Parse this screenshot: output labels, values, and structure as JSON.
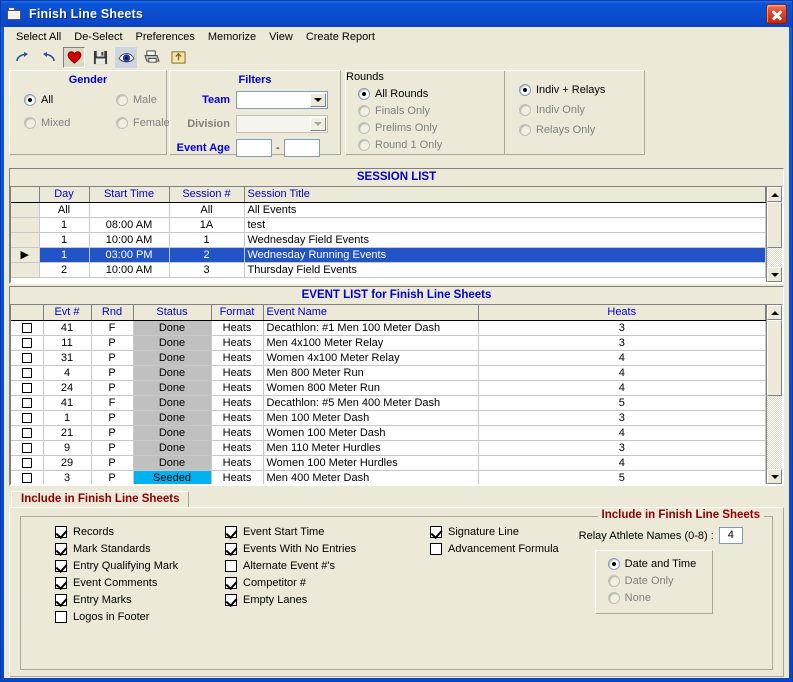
{
  "window": {
    "title": "Finish Line Sheets",
    "title_icon": "folder-icon",
    "close_icon": "close-icon"
  },
  "menubar": [
    {
      "label": "Select All"
    },
    {
      "label": "De-Select"
    },
    {
      "label": "Preferences"
    },
    {
      "label": "Memorize"
    },
    {
      "label": "View"
    },
    {
      "label": "Create Report"
    }
  ],
  "toolbar": [
    {
      "name": "redo-icon",
      "title": "Redo"
    },
    {
      "name": "undo-icon",
      "title": "Undo"
    },
    {
      "name": "heart-icon",
      "title": "Favorites"
    },
    {
      "name": "save-icon",
      "title": "Save"
    },
    {
      "name": "preview-eye-icon",
      "title": "Preview"
    },
    {
      "name": "printer-icon",
      "title": "Print"
    },
    {
      "name": "export-folder-icon",
      "title": "Export"
    }
  ],
  "gender": {
    "title": "Gender",
    "options": [
      {
        "label": "All",
        "selected": true
      },
      {
        "label": "Male",
        "selected": false
      },
      {
        "label": "Mixed",
        "selected": false
      },
      {
        "label": "Female",
        "selected": false
      }
    ]
  },
  "filters": {
    "title": "Filters",
    "team_label": "Team",
    "team_value": "",
    "division_label": "Division",
    "division_value": "",
    "division_disabled": true,
    "event_age_label": "Event Age",
    "event_age_from": "",
    "event_age_sep": "-",
    "event_age_to": ""
  },
  "rounds": {
    "title": "Rounds",
    "options": [
      {
        "label": "All Rounds",
        "selected": true
      },
      {
        "label": "Finals Only",
        "selected": false
      },
      {
        "label": "Prelims Only",
        "selected": false
      },
      {
        "label": "Round 1 Only",
        "selected": false
      }
    ]
  },
  "event_kind": {
    "options": [
      {
        "label": "Indiv + Relays",
        "selected": true
      },
      {
        "label": "Indiv Only",
        "selected": false
      },
      {
        "label": "Relays Only",
        "selected": false
      }
    ]
  },
  "session_list": {
    "caption": "SESSION LIST",
    "columns": [
      "",
      "Day",
      "Start Time",
      "Session #",
      "Session Title"
    ],
    "rows": [
      {
        "marker": "",
        "day": "All",
        "start": "",
        "session": "All",
        "title": "All Events",
        "selected": false
      },
      {
        "marker": "",
        "day": "1",
        "start": "08:00 AM",
        "session": "1A",
        "title": "test",
        "selected": false
      },
      {
        "marker": "",
        "day": "1",
        "start": "10:00 AM",
        "session": "1",
        "title": "Wednesday Field Events",
        "selected": false
      },
      {
        "marker": "▶",
        "day": "1",
        "start": "03:00 PM",
        "session": "2",
        "title": "Wednesday Running Events",
        "selected": true
      },
      {
        "marker": "",
        "day": "2",
        "start": "10:00 AM",
        "session": "3",
        "title": "Thursday Field Events",
        "selected": false
      }
    ]
  },
  "event_list": {
    "caption": "EVENT LIST for Finish Line Sheets",
    "columns": [
      "",
      "Evt #",
      "Rnd",
      "Status",
      "Format",
      "Event Name",
      "Heats"
    ],
    "rows": [
      {
        "evt": "41",
        "rnd": "F",
        "status": "Done",
        "format": "Heats",
        "name": "Decathlon: #1 Men 100 Meter Dash",
        "heats": "3"
      },
      {
        "evt": "11",
        "rnd": "P",
        "status": "Done",
        "format": "Heats",
        "name": "Men 4x100 Meter Relay",
        "heats": "3"
      },
      {
        "evt": "31",
        "rnd": "P",
        "status": "Done",
        "format": "Heats",
        "name": "Women 4x100 Meter Relay",
        "heats": "4"
      },
      {
        "evt": "4",
        "rnd": "P",
        "status": "Done",
        "format": "Heats",
        "name": "Men 800 Meter Run",
        "heats": "4"
      },
      {
        "evt": "24",
        "rnd": "P",
        "status": "Done",
        "format": "Heats",
        "name": "Women 800 Meter Run",
        "heats": "4"
      },
      {
        "evt": "41",
        "rnd": "F",
        "status": "Done",
        "format": "Heats",
        "name": "Decathlon: #5 Men 400 Meter Dash",
        "heats": "5"
      },
      {
        "evt": "1",
        "rnd": "P",
        "status": "Done",
        "format": "Heats",
        "name": "Men 100 Meter Dash",
        "heats": "3"
      },
      {
        "evt": "21",
        "rnd": "P",
        "status": "Done",
        "format": "Heats",
        "name": "Women 100 Meter Dash",
        "heats": "4"
      },
      {
        "evt": "9",
        "rnd": "P",
        "status": "Done",
        "format": "Heats",
        "name": "Men 110 Meter Hurdles",
        "heats": "3"
      },
      {
        "evt": "29",
        "rnd": "P",
        "status": "Done",
        "format": "Heats",
        "name": "Women 100 Meter Hurdles",
        "heats": "4"
      },
      {
        "evt": "3",
        "rnd": "P",
        "status": "Seeded",
        "format": "Heats",
        "name": "Men 400 Meter Dash",
        "heats": "5"
      }
    ]
  },
  "tab": {
    "label": "Include in Finish Line Sheets"
  },
  "include_panel": {
    "legend": "Include in Finish Line Sheets",
    "column1": [
      {
        "label": "Records",
        "checked": true
      },
      {
        "label": "Mark Standards",
        "checked": true
      },
      {
        "label": "Entry Qualifying Mark",
        "checked": true
      },
      {
        "label": "Event Comments",
        "checked": true
      },
      {
        "label": "Entry Marks",
        "checked": true
      },
      {
        "label": "Logos in Footer",
        "checked": false
      }
    ],
    "column2": [
      {
        "label": "Event Start Time",
        "checked": true
      },
      {
        "label": "Events With No Entries",
        "checked": true
      },
      {
        "label": "Alternate Event #'s",
        "checked": false
      },
      {
        "label": "Competitor #",
        "checked": true
      },
      {
        "label": "Empty Lanes",
        "checked": true
      }
    ],
    "column3": [
      {
        "label": "Signature Line",
        "checked": true
      },
      {
        "label": "Advancement Formula",
        "checked": false
      }
    ],
    "relay_label": "Relay Athlete Names (0-8) :",
    "relay_value": "4",
    "datetime_options": [
      {
        "label": "Date and Time",
        "selected": true
      },
      {
        "label": "Date Only",
        "selected": false
      },
      {
        "label": "None",
        "selected": false
      }
    ]
  },
  "colors": {
    "title_blue": "#0a46c8",
    "face": "#ece9d8",
    "header_text": "#0000cd",
    "selection": "#2254c8",
    "status_done": "#c0c0c0",
    "status_seeded": "#00b2f0",
    "legend_red": "#8b0000"
  }
}
